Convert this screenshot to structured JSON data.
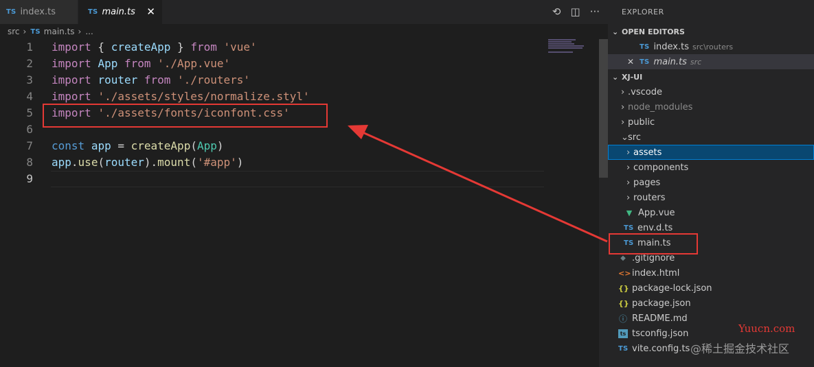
{
  "tabs": [
    {
      "lang": "TS",
      "label": "index.ts"
    },
    {
      "lang": "TS",
      "label": "main.ts",
      "close": "✕"
    }
  ],
  "toolbar": {
    "history_icon": "⟲",
    "split_icon": "◫",
    "more_icon": "···"
  },
  "breadcrumb": {
    "folder": "src",
    "lang": "TS",
    "file": "main.ts",
    "more": "..."
  },
  "code": {
    "line_numbers": [
      "1",
      "2",
      "3",
      "4",
      "5",
      "6",
      "7",
      "8",
      "9"
    ],
    "lines": [
      [
        [
          "kw",
          "import"
        ],
        [
          "pun",
          " { "
        ],
        [
          "id",
          "createApp"
        ],
        [
          "pun",
          " } "
        ],
        [
          "kw",
          "from"
        ],
        [
          "pun",
          " "
        ],
        [
          "str",
          "'vue'"
        ]
      ],
      [
        [
          "kw",
          "import"
        ],
        [
          "pun",
          " "
        ],
        [
          "id",
          "App"
        ],
        [
          "pun",
          " "
        ],
        [
          "kw",
          "from"
        ],
        [
          "pun",
          " "
        ],
        [
          "str",
          "'./App.vue'"
        ]
      ],
      [
        [
          "kw",
          "import"
        ],
        [
          "pun",
          " "
        ],
        [
          "id",
          "router"
        ],
        [
          "pun",
          " "
        ],
        [
          "kw",
          "from"
        ],
        [
          "pun",
          " "
        ],
        [
          "str",
          "'./routers'"
        ]
      ],
      [
        [
          "kw",
          "import"
        ],
        [
          "pun",
          " "
        ],
        [
          "str",
          "'./assets/styles/normalize.styl'"
        ]
      ],
      [
        [
          "kw",
          "import"
        ],
        [
          "pun",
          " "
        ],
        [
          "str",
          "'./assets/fonts/iconfont.css'"
        ]
      ],
      [],
      [
        [
          "kw2",
          "const"
        ],
        [
          "pun",
          " "
        ],
        [
          "id",
          "app"
        ],
        [
          "pun",
          " = "
        ],
        [
          "fn",
          "createApp"
        ],
        [
          "pun",
          "("
        ],
        [
          "cls",
          "App"
        ],
        [
          "pun",
          ")"
        ]
      ],
      [
        [
          "id",
          "app"
        ],
        [
          "pun",
          "."
        ],
        [
          "fn",
          "use"
        ],
        [
          "pun",
          "("
        ],
        [
          "id",
          "router"
        ],
        [
          "pun",
          ")."
        ],
        [
          "fn",
          "mount"
        ],
        [
          "pun",
          "("
        ],
        [
          "str",
          "'#app'"
        ],
        [
          "pun",
          ")"
        ]
      ],
      []
    ]
  },
  "explorer": {
    "title": "EXPLORER",
    "open_editors": {
      "header": "OPEN EDITORS",
      "items": [
        {
          "lang": "TS",
          "name": "index.ts",
          "desc": "src\\routers"
        },
        {
          "lang": "TS",
          "name": "main.ts",
          "desc": "src",
          "close": "✕"
        }
      ]
    },
    "project": {
      "header": "XJ-UI",
      "items": [
        {
          "name": ".vscode",
          "chev": "›"
        },
        {
          "name": "node_modules",
          "chev": "›"
        },
        {
          "name": "public",
          "chev": "›"
        },
        {
          "name": "src",
          "chev": "⌄"
        },
        {
          "name": "assets",
          "chev": "›"
        },
        {
          "name": "components",
          "chev": "›"
        },
        {
          "name": "pages",
          "chev": "›"
        },
        {
          "name": "routers",
          "chev": "›"
        },
        {
          "name": "App.vue",
          "icon": "▼"
        },
        {
          "name": "env.d.ts",
          "icon": "TS"
        },
        {
          "name": "main.ts",
          "icon": "TS"
        },
        {
          "name": ".gitignore",
          "icon": "◆"
        },
        {
          "name": "index.html",
          "icon": "<>"
        },
        {
          "name": "package-lock.json",
          "icon": "{}"
        },
        {
          "name": "package.json",
          "icon": "{}"
        },
        {
          "name": "README.md",
          "icon": "ⓘ"
        },
        {
          "name": "tsconfig.json",
          "icon": "ts"
        },
        {
          "name": "vite.config.ts",
          "icon": "TS"
        }
      ]
    }
  },
  "watermarks": {
    "site": "Yuucn.com",
    "community": "@稀土掘金技术社区"
  },
  "colors": {
    "annotation": "#e53935",
    "selection": "#094771",
    "ts_icon": "#4b9ad6"
  }
}
